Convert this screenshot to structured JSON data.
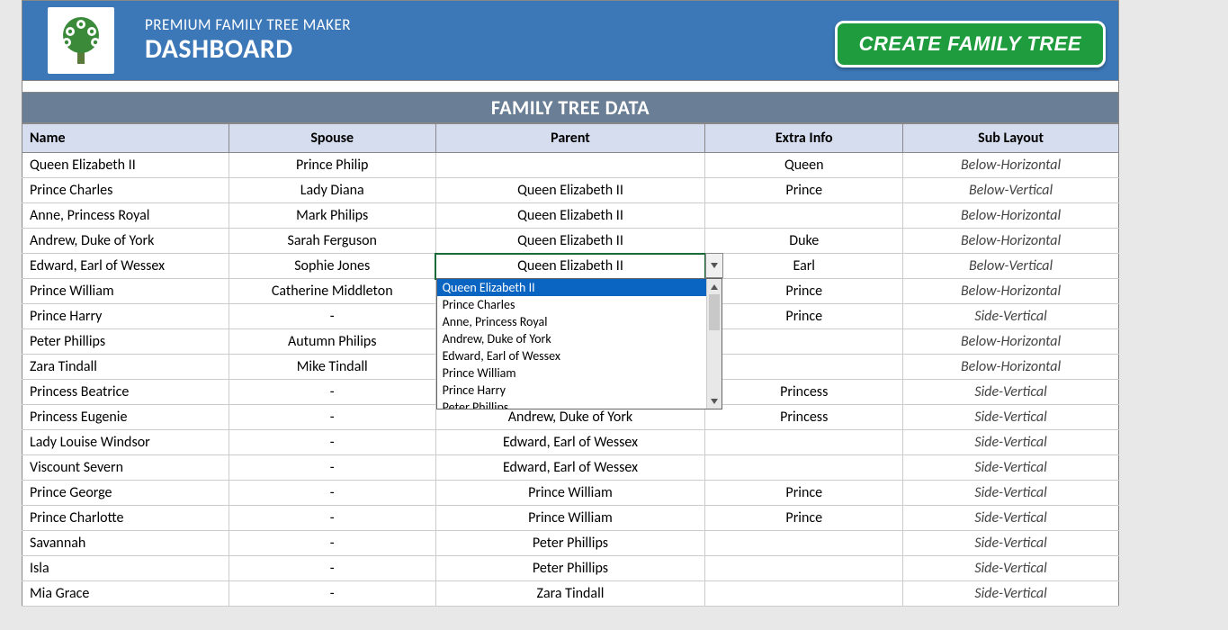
{
  "header": {
    "subtitle": "PREMIUM FAMILY TREE MAKER",
    "title": "DASHBOARD",
    "create_button": "CREATE FAMILY TREE"
  },
  "section_title": "FAMILY TREE DATA",
  "columns": [
    "Name",
    "Spouse",
    "Parent",
    "Extra Info",
    "Sub Layout"
  ],
  "rows": [
    {
      "name": "Queen Elizabeth II",
      "spouse": "Prince Philip",
      "parent": "",
      "extra": "Queen",
      "layout": "Below-Horizontal"
    },
    {
      "name": "Prince Charles",
      "spouse": "Lady Diana",
      "parent": "Queen Elizabeth II",
      "extra": "Prince",
      "layout": "Below-Vertical"
    },
    {
      "name": "Anne, Princess Royal",
      "spouse": "Mark Philips",
      "parent": "Queen Elizabeth II",
      "extra": "",
      "layout": "Below-Horizontal"
    },
    {
      "name": "Andrew, Duke of York",
      "spouse": "Sarah Ferguson",
      "parent": "Queen Elizabeth II",
      "extra": "Duke",
      "layout": "Below-Horizontal"
    },
    {
      "name": "Edward, Earl of Wessex",
      "spouse": "Sophie Jones",
      "parent": "Queen Elizabeth II",
      "extra": "Earl",
      "layout": "Below-Vertical",
      "active": true
    },
    {
      "name": "Prince William",
      "spouse": "Catherine Middleton",
      "parent": "",
      "extra": "Prince",
      "layout": "Below-Horizontal"
    },
    {
      "name": "Prince Harry",
      "spouse": "-",
      "parent": "",
      "extra": "Prince",
      "layout": "Side-Vertical"
    },
    {
      "name": "Peter Phillips",
      "spouse": "Autumn Philips",
      "parent": "",
      "extra": "",
      "layout": "Below-Horizontal"
    },
    {
      "name": "Zara Tindall",
      "spouse": "Mike Tindall",
      "parent": "",
      "extra": "",
      "layout": "Below-Horizontal"
    },
    {
      "name": "Princess Beatrice",
      "spouse": "-",
      "parent": "",
      "extra": "Princess",
      "layout": "Side-Vertical"
    },
    {
      "name": "Princess Eugenie",
      "spouse": "-",
      "parent": "Andrew, Duke of York",
      "extra": "Princess",
      "layout": "Side-Vertical"
    },
    {
      "name": "Lady Louise Windsor",
      "spouse": "-",
      "parent": "Edward, Earl of Wessex",
      "extra": "",
      "layout": "Side-Vertical"
    },
    {
      "name": "Viscount Severn",
      "spouse": "-",
      "parent": "Edward, Earl of Wessex",
      "extra": "",
      "layout": "Side-Vertical"
    },
    {
      "name": "Prince George",
      "spouse": "-",
      "parent": "Prince William",
      "extra": "Prince",
      "layout": "Side-Vertical"
    },
    {
      "name": "Prince Charlotte",
      "spouse": "-",
      "parent": "Prince William",
      "extra": "Prince",
      "layout": "Side-Vertical"
    },
    {
      "name": "Savannah",
      "spouse": "-",
      "parent": "Peter Phillips",
      "extra": "",
      "layout": "Side-Vertical"
    },
    {
      "name": "Isla",
      "spouse": "-",
      "parent": "Peter Phillips",
      "extra": "",
      "layout": "Side-Vertical"
    },
    {
      "name": "Mia Grace",
      "spouse": "-",
      "parent": "Zara Tindall",
      "extra": "",
      "layout": "Side-Vertical"
    }
  ],
  "dropdown": {
    "open_on_row": 4,
    "selected_index": 0,
    "options": [
      "Queen Elizabeth II",
      "Prince Charles",
      "Anne, Princess Royal",
      "Andrew, Duke of York",
      "Edward, Earl of Wessex",
      "Prince William",
      "Prince Harry",
      "Peter Phillips"
    ]
  }
}
